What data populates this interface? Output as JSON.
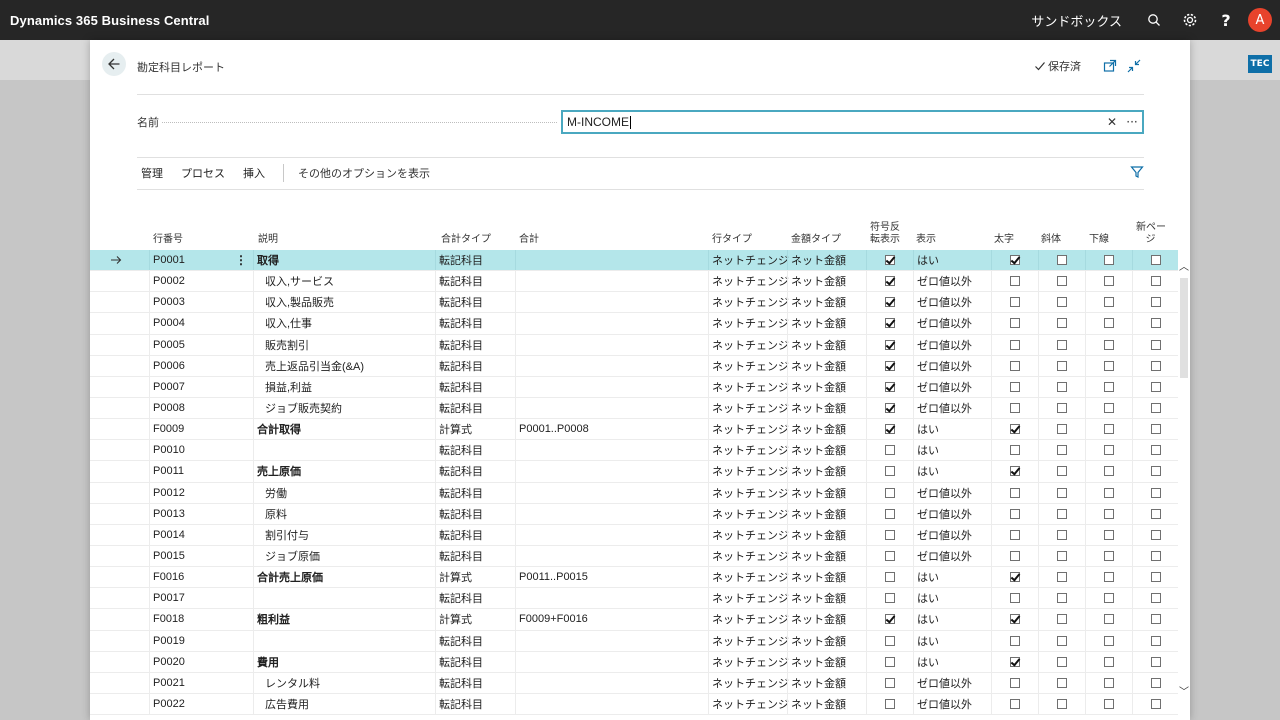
{
  "app_title": "Dynamics 365 Business Central",
  "environment": "サンドボックス",
  "avatar_initial": "A",
  "company_badge": "TEC",
  "page": {
    "title": "勘定科目レポート",
    "saved_label": "保存済",
    "name_label": "名前",
    "name_value": "M-INCOME"
  },
  "actions": {
    "manage": "管理",
    "process": "プロセス",
    "insert": "挿入",
    "more": "その他のオプションを表示"
  },
  "columns": {
    "row_no": "行番号",
    "desc": "説明",
    "totaling_type": "合計タイプ",
    "totaling": "合計",
    "row_type": "行タイプ",
    "amount_type": "金額タイプ",
    "sign_a": "符号反",
    "sign_b": "転表示",
    "show": "表示",
    "bold": "太字",
    "italic": "斜体",
    "underline": "下線",
    "newpage_a": "新ペー",
    "newpage_b": "ジ"
  },
  "rows": [
    {
      "no": "P0001",
      "desc": "取得",
      "bold": true,
      "indent": 0,
      "ttype": "転記科目",
      "tot": "",
      "rtype": "ネットチェンジ",
      "atype": "ネット金額",
      "sign": true,
      "show": "はい",
      "b": true,
      "i": false,
      "u": false,
      "np": false,
      "selected": true
    },
    {
      "no": "P0002",
      "desc": "収入,サービス",
      "bold": false,
      "indent": 1,
      "ttype": "転記科目",
      "tot": "",
      "rtype": "ネットチェンジ",
      "atype": "ネット金額",
      "sign": true,
      "show": "ゼロ値以外",
      "b": false,
      "i": false,
      "u": false,
      "np": false
    },
    {
      "no": "P0003",
      "desc": "収入,製品販売",
      "bold": false,
      "indent": 1,
      "ttype": "転記科目",
      "tot": "",
      "rtype": "ネットチェンジ",
      "atype": "ネット金額",
      "sign": true,
      "show": "ゼロ値以外",
      "b": false,
      "i": false,
      "u": false,
      "np": false
    },
    {
      "no": "P0004",
      "desc": "収入,仕事",
      "bold": false,
      "indent": 1,
      "ttype": "転記科目",
      "tot": "",
      "rtype": "ネットチェンジ",
      "atype": "ネット金額",
      "sign": true,
      "show": "ゼロ値以外",
      "b": false,
      "i": false,
      "u": false,
      "np": false
    },
    {
      "no": "P0005",
      "desc": "販売割引",
      "bold": false,
      "indent": 1,
      "ttype": "転記科目",
      "tot": "",
      "rtype": "ネットチェンジ",
      "atype": "ネット金額",
      "sign": true,
      "show": "ゼロ値以外",
      "b": false,
      "i": false,
      "u": false,
      "np": false
    },
    {
      "no": "P0006",
      "desc": "売上返品引当金(&A)",
      "bold": false,
      "indent": 1,
      "ttype": "転記科目",
      "tot": "",
      "rtype": "ネットチェンジ",
      "atype": "ネット金額",
      "sign": true,
      "show": "ゼロ値以外",
      "b": false,
      "i": false,
      "u": false,
      "np": false
    },
    {
      "no": "P0007",
      "desc": "損益,利益",
      "bold": false,
      "indent": 1,
      "ttype": "転記科目",
      "tot": "",
      "rtype": "ネットチェンジ",
      "atype": "ネット金額",
      "sign": true,
      "show": "ゼロ値以外",
      "b": false,
      "i": false,
      "u": false,
      "np": false
    },
    {
      "no": "P0008",
      "desc": "ジョブ販売契約",
      "bold": false,
      "indent": 1,
      "ttype": "転記科目",
      "tot": "",
      "rtype": "ネットチェンジ",
      "atype": "ネット金額",
      "sign": true,
      "show": "ゼロ値以外",
      "b": false,
      "i": false,
      "u": false,
      "np": false
    },
    {
      "no": "F0009",
      "desc": "合計取得",
      "bold": true,
      "indent": 0,
      "ttype": "計算式",
      "tot": "P0001..P0008",
      "rtype": "ネットチェンジ",
      "atype": "ネット金額",
      "sign": true,
      "show": "はい",
      "b": true,
      "i": false,
      "u": false,
      "np": false
    },
    {
      "no": "P0010",
      "desc": "",
      "bold": false,
      "indent": 0,
      "ttype": "転記科目",
      "tot": "",
      "rtype": "ネットチェンジ",
      "atype": "ネット金額",
      "sign": false,
      "show": "はい",
      "b": false,
      "i": false,
      "u": false,
      "np": false
    },
    {
      "no": "P0011",
      "desc": "売上原価",
      "bold": true,
      "indent": 0,
      "ttype": "転記科目",
      "tot": "",
      "rtype": "ネットチェンジ",
      "atype": "ネット金額",
      "sign": false,
      "show": "はい",
      "b": true,
      "i": false,
      "u": false,
      "np": false
    },
    {
      "no": "P0012",
      "desc": "労働",
      "bold": false,
      "indent": 1,
      "ttype": "転記科目",
      "tot": "",
      "rtype": "ネットチェンジ",
      "atype": "ネット金額",
      "sign": false,
      "show": "ゼロ値以外",
      "b": false,
      "i": false,
      "u": false,
      "np": false
    },
    {
      "no": "P0013",
      "desc": "原料",
      "bold": false,
      "indent": 1,
      "ttype": "転記科目",
      "tot": "",
      "rtype": "ネットチェンジ",
      "atype": "ネット金額",
      "sign": false,
      "show": "ゼロ値以外",
      "b": false,
      "i": false,
      "u": false,
      "np": false
    },
    {
      "no": "P0014",
      "desc": "割引付与",
      "bold": false,
      "indent": 1,
      "ttype": "転記科目",
      "tot": "",
      "rtype": "ネットチェンジ",
      "atype": "ネット金額",
      "sign": false,
      "show": "ゼロ値以外",
      "b": false,
      "i": false,
      "u": false,
      "np": false
    },
    {
      "no": "P0015",
      "desc": "ジョブ原価",
      "bold": false,
      "indent": 1,
      "ttype": "転記科目",
      "tot": "",
      "rtype": "ネットチェンジ",
      "atype": "ネット金額",
      "sign": false,
      "show": "ゼロ値以外",
      "b": false,
      "i": false,
      "u": false,
      "np": false
    },
    {
      "no": "F0016",
      "desc": "合計売上原価",
      "bold": true,
      "indent": 0,
      "ttype": "計算式",
      "tot": "P0011..P0015",
      "rtype": "ネットチェンジ",
      "atype": "ネット金額",
      "sign": false,
      "show": "はい",
      "b": true,
      "i": false,
      "u": false,
      "np": false
    },
    {
      "no": "P0017",
      "desc": "",
      "bold": false,
      "indent": 0,
      "ttype": "転記科目",
      "tot": "",
      "rtype": "ネットチェンジ",
      "atype": "ネット金額",
      "sign": false,
      "show": "はい",
      "b": false,
      "i": false,
      "u": false,
      "np": false
    },
    {
      "no": "F0018",
      "desc": "粗利益",
      "bold": true,
      "indent": 0,
      "ttype": "計算式",
      "tot": "F0009+F0016",
      "rtype": "ネットチェンジ",
      "atype": "ネット金額",
      "sign": true,
      "show": "はい",
      "b": true,
      "i": false,
      "u": false,
      "np": false
    },
    {
      "no": "P0019",
      "desc": "",
      "bold": false,
      "indent": 0,
      "ttype": "転記科目",
      "tot": "",
      "rtype": "ネットチェンジ",
      "atype": "ネット金額",
      "sign": false,
      "show": "はい",
      "b": false,
      "i": false,
      "u": false,
      "np": false
    },
    {
      "no": "P0020",
      "desc": "費用",
      "bold": true,
      "indent": 0,
      "ttype": "転記科目",
      "tot": "",
      "rtype": "ネットチェンジ",
      "atype": "ネット金額",
      "sign": false,
      "show": "はい",
      "b": true,
      "i": false,
      "u": false,
      "np": false
    },
    {
      "no": "P0021",
      "desc": "レンタル料",
      "bold": false,
      "indent": 1,
      "ttype": "転記科目",
      "tot": "",
      "rtype": "ネットチェンジ",
      "atype": "ネット金額",
      "sign": false,
      "show": "ゼロ値以外",
      "b": false,
      "i": false,
      "u": false,
      "np": false
    },
    {
      "no": "P0022",
      "desc": "広告費用",
      "bold": false,
      "indent": 1,
      "ttype": "転記科目",
      "tot": "",
      "rtype": "ネットチェンジ",
      "atype": "ネット金額",
      "sign": false,
      "show": "ゼロ値以外",
      "b": false,
      "i": false,
      "u": false,
      "np": false
    }
  ]
}
